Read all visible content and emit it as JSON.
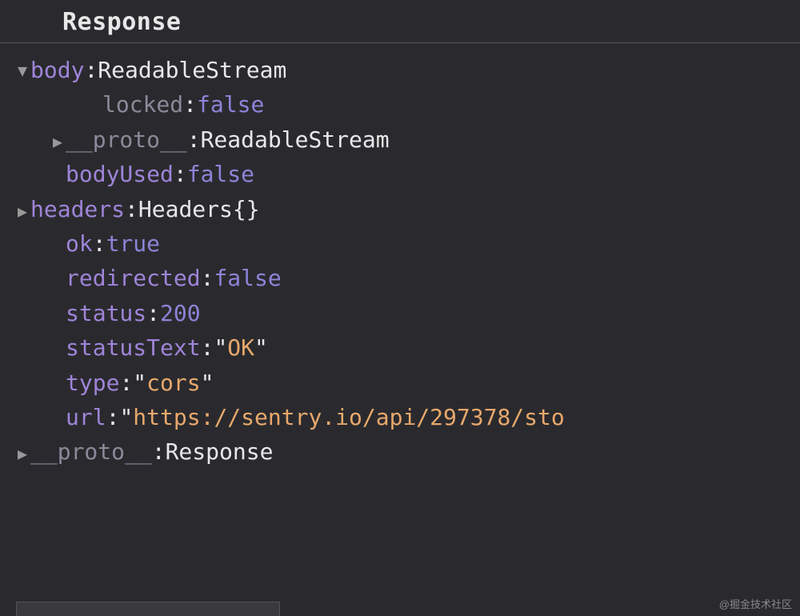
{
  "header": {
    "title": "Response"
  },
  "rows": [
    {
      "indent": 0,
      "arrow": "expanded",
      "key": "body",
      "keyStyle": "key",
      "valType": "type",
      "val": "ReadableStream"
    },
    {
      "indent": 2,
      "arrow": "none",
      "key": "locked",
      "keyStyle": "key-dim",
      "valType": "bool",
      "val": "false"
    },
    {
      "indent": 1,
      "arrow": "collapsed",
      "key": "__proto__",
      "keyStyle": "key-dim",
      "valType": "type",
      "val": "ReadableStream"
    },
    {
      "indent": 1,
      "arrow": "none",
      "key": "bodyUsed",
      "keyStyle": "key",
      "valType": "bool",
      "val": "false"
    },
    {
      "indent": 0,
      "arrow": "collapsed",
      "key": "headers",
      "keyStyle": "key",
      "valType": "type-braces",
      "val": "Headers",
      "suffix": "{}"
    },
    {
      "indent": 1,
      "arrow": "none",
      "key": "ok",
      "keyStyle": "key",
      "valType": "bool",
      "val": "true"
    },
    {
      "indent": 1,
      "arrow": "none",
      "key": "redirected",
      "keyStyle": "key",
      "valType": "bool",
      "val": "false"
    },
    {
      "indent": 1,
      "arrow": "none",
      "key": "status",
      "keyStyle": "key",
      "valType": "num",
      "val": "200"
    },
    {
      "indent": 1,
      "arrow": "none",
      "key": "statusText",
      "keyStyle": "key",
      "valType": "str",
      "val": "OK"
    },
    {
      "indent": 1,
      "arrow": "none",
      "key": "type",
      "keyStyle": "key",
      "valType": "str",
      "val": "cors"
    },
    {
      "indent": 1,
      "arrow": "none",
      "key": "url",
      "keyStyle": "key",
      "valType": "str-open",
      "val": "https://sentry.io/api/297378/sto"
    },
    {
      "indent": 0,
      "arrow": "collapsed",
      "key": "__proto__",
      "keyStyle": "key-dim",
      "valType": "type",
      "val": "Response"
    }
  ],
  "watermark": "@掘金技术社区"
}
